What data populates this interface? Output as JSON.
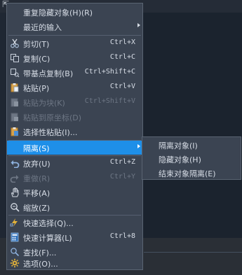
{
  "menu": {
    "items": [
      {
        "label": "重复隐藏对象(H)(R)"
      },
      {
        "label": "最近的输入"
      },
      {
        "label": "剪切(T)",
        "shortcut": "Ctrl+X",
        "icon": "scissors-icon"
      },
      {
        "label": "复制(C)",
        "shortcut": "Ctrl+C",
        "icon": "copy-icon"
      },
      {
        "label": "带基点复制(B)",
        "shortcut": "Ctrl+Shift+C",
        "icon": "copy-basepoint-icon"
      },
      {
        "label": "粘贴(P)",
        "shortcut": "Ctrl+V",
        "icon": "paste-icon"
      },
      {
        "label": "粘贴为块(K)",
        "shortcut": "Ctrl+Shift+V",
        "icon": "paste-block-icon"
      },
      {
        "label": "粘贴到原坐标(D)",
        "icon": "paste-original-coords-icon"
      },
      {
        "label": "选择性粘贴(I)...",
        "icon": "paste-special-icon"
      },
      {
        "label": "隔离(S)"
      },
      {
        "label": "放弃(U)",
        "shortcut": "Ctrl+Z",
        "icon": "undo-icon"
      },
      {
        "label": "重做(R)",
        "shortcut": "Ctrl+Y",
        "icon": "redo-icon"
      },
      {
        "label": "平移(A)",
        "icon": "pan-hand-icon"
      },
      {
        "label": "缩放(Z)",
        "icon": "zoom-icon"
      },
      {
        "label": "快速选择(Q)...",
        "icon": "quick-select-icon"
      },
      {
        "label": "快速计算器(L)",
        "shortcut": "Ctrl+8",
        "icon": "calculator-icon"
      },
      {
        "label": "查找(F)...",
        "icon": "find-icon"
      },
      {
        "label": "选项(O)...",
        "icon": "options-gear-icon"
      }
    ]
  },
  "submenu": {
    "items": [
      {
        "label": "隔离对象(I)"
      },
      {
        "label": "隐藏对象(H)"
      },
      {
        "label": "结束对象隔离(E)"
      }
    ]
  },
  "colors": {
    "highlight": "#1e8fe8",
    "menu_bg": "#3b4452",
    "disabled_text": "#6d7684"
  }
}
